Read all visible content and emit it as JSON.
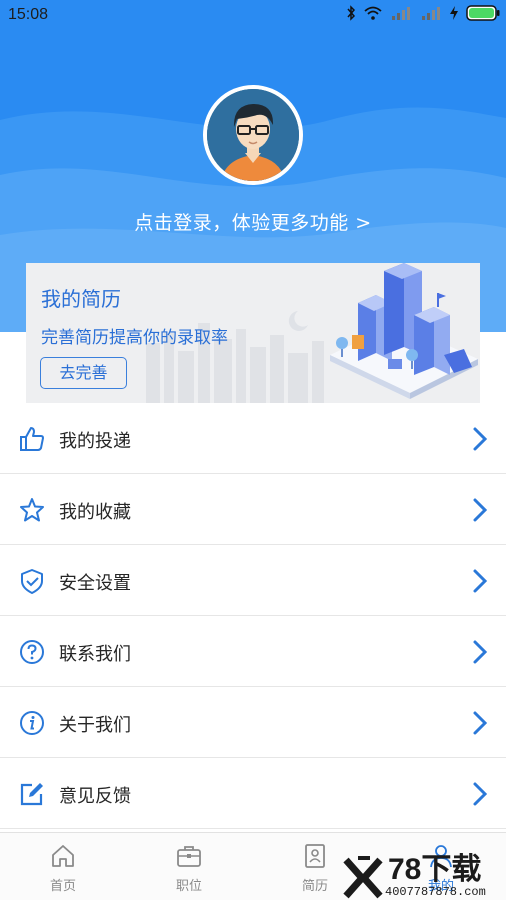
{
  "status_bar": {
    "time": "15:08"
  },
  "profile": {
    "login_prompt": "点击登录，体验更多功能 >"
  },
  "resume_card": {
    "title": "我的简历",
    "subtitle": "完善简历提高你的录取率",
    "button_label": "去完善"
  },
  "menu": {
    "items": [
      {
        "label": "我的投递",
        "icon": "thumbs-up-icon"
      },
      {
        "label": "我的收藏",
        "icon": "star-icon"
      },
      {
        "label": "安全设置",
        "icon": "shield-check-icon"
      },
      {
        "label": "联系我们",
        "icon": "question-circle-icon"
      },
      {
        "label": "关于我们",
        "icon": "info-circle-icon"
      },
      {
        "label": "意见反馈",
        "icon": "edit-icon"
      }
    ]
  },
  "tabbar": {
    "tabs": [
      {
        "label": "首页",
        "icon": "home-icon"
      },
      {
        "label": "职位",
        "icon": "briefcase-icon"
      },
      {
        "label": "简历",
        "icon": "resume-icon"
      },
      {
        "label": "我的",
        "icon": "user-icon"
      }
    ]
  },
  "watermark": {
    "brand": "78下载",
    "phone": "4007787878.com"
  },
  "colors": {
    "primary": "#2a8bf2",
    "link_blue": "#2a6fd6",
    "text": "#262626",
    "tab_text": "#8a8a8a"
  }
}
